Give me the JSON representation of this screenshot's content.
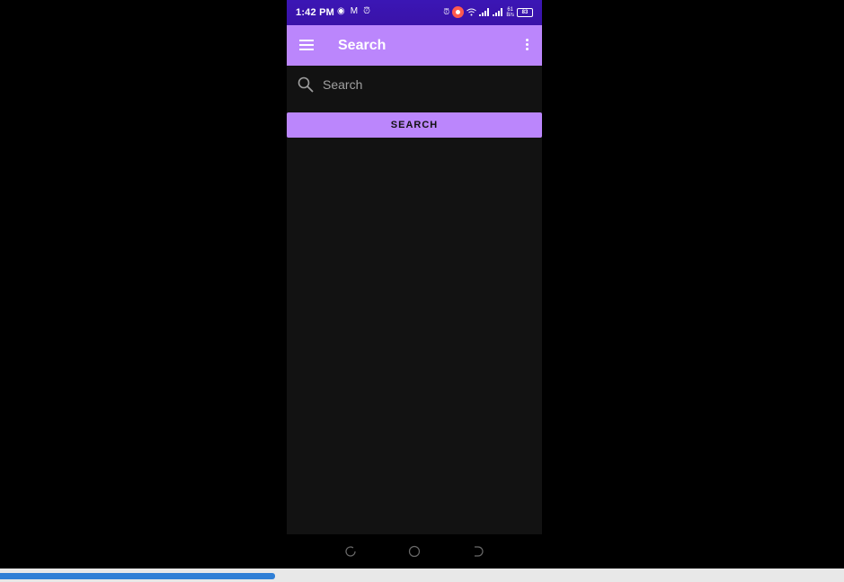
{
  "status_bar": {
    "time": "1:42 PM",
    "network_speed_top": "61",
    "network_speed_bottom": "B/s",
    "battery": "83",
    "left_icons": [
      "screen-record-icon",
      "gmail-icon",
      "alarm-icon"
    ],
    "right_icons": [
      "alarm-icon",
      "recording-icon",
      "wifi-icon",
      "signal-icon",
      "signal-icon",
      "battery-icon"
    ]
  },
  "app_bar": {
    "title": "Search",
    "background_color": "#bb86fc"
  },
  "search": {
    "placeholder": "Search",
    "value": "",
    "button_label": "SEARCH"
  },
  "nav_bar": {
    "buttons": [
      "recents",
      "home",
      "back"
    ]
  },
  "progress": {
    "fraction": 0.326,
    "color": "#2f7fd6"
  }
}
